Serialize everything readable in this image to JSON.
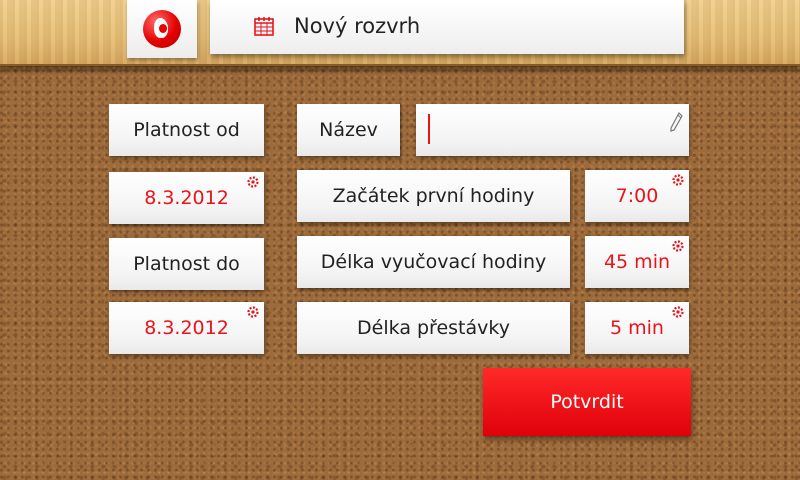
{
  "header": {
    "title": "Nový rozvrh"
  },
  "form": {
    "valid_from_label": "Platnost od",
    "valid_from_value": "8.3.2012",
    "valid_to_label": "Platnost do",
    "valid_to_value": "8.3.2012",
    "name_label": "Název",
    "name_value": "",
    "first_lesson_label": "Začátek první hodiny",
    "first_lesson_value": "7:00",
    "lesson_length_label": "Délka vyučovací hodiny",
    "lesson_length_value": "45 min",
    "break_length_label": "Délka přestávky",
    "break_length_value": "5 min"
  },
  "actions": {
    "confirm_label": "Potvrdit"
  },
  "colors": {
    "accent": "#e8141a",
    "brand_red": "#e60000"
  },
  "icons": [
    "vodafone-logo",
    "calendar-icon",
    "gear-icon",
    "pencil-icon"
  ]
}
